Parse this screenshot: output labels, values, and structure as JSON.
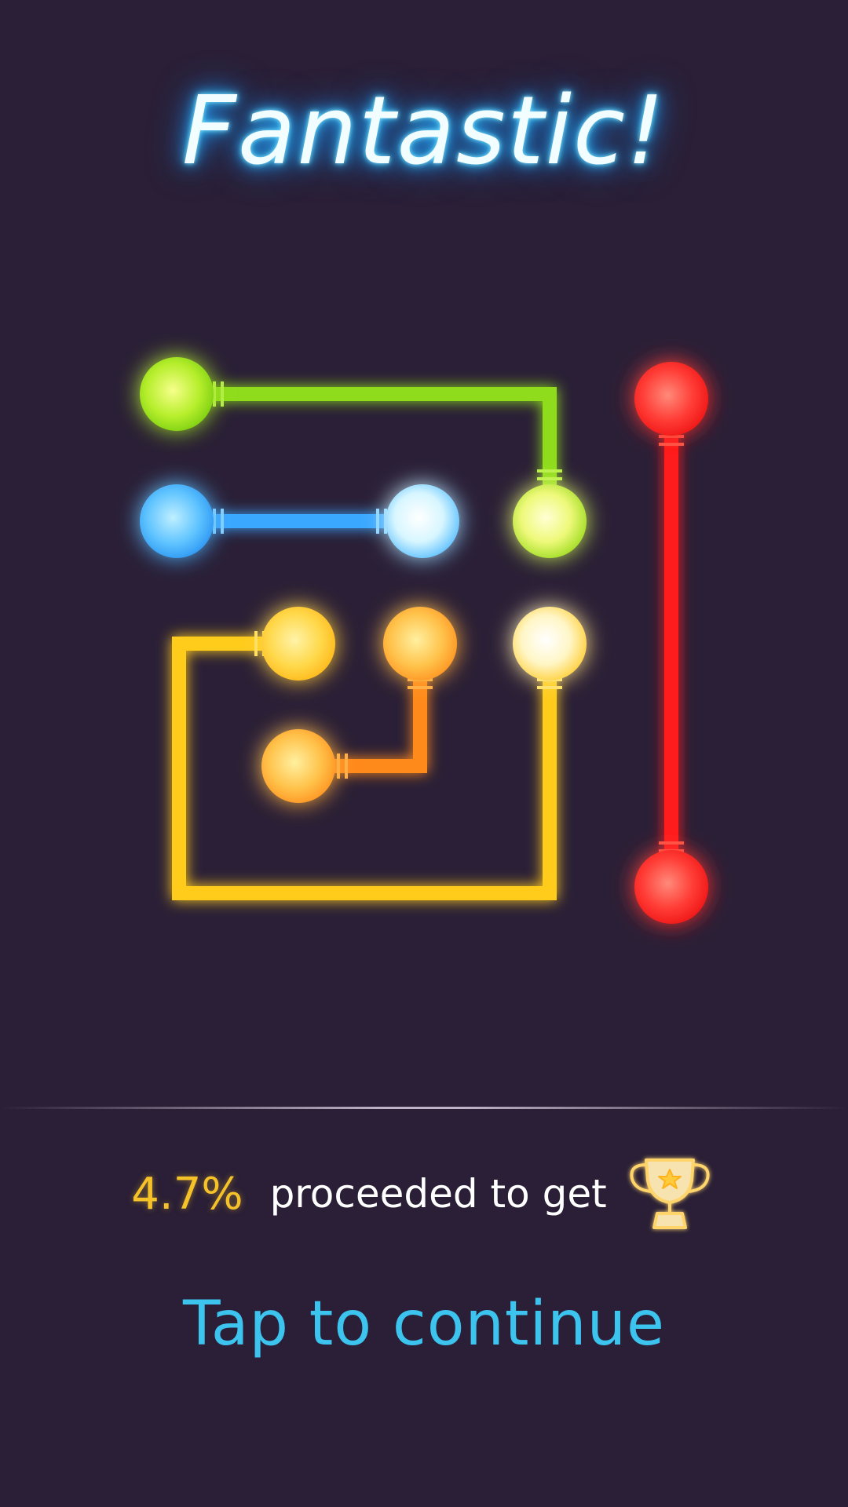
{
  "header": {
    "title": "Fantastic!"
  },
  "result": {
    "percent": "4.7%",
    "text": "proceeded to get",
    "trophy_icon": "trophy-icon"
  },
  "actions": {
    "continue_label": "Tap to continue"
  },
  "colors": {
    "background": "#2a1f36",
    "title_glow": "#35c4ff",
    "percent": "#f5c22a",
    "continue": "#3cc3ee",
    "green": "#8edc1e",
    "blue": "#3aa8ff",
    "yellow": "#ffcc1a",
    "orange": "#ff8a1e",
    "red": "#ff1f1f"
  },
  "puzzle": {
    "connections": [
      {
        "color": "green",
        "endpoints": [
          "green-light-start",
          "green-light-end"
        ]
      },
      {
        "color": "blue",
        "endpoints": [
          "blue-light-start",
          "blue-light-end"
        ]
      },
      {
        "color": "yellow",
        "endpoints": [
          "yellow-light-start",
          "yellow-light-end"
        ]
      },
      {
        "color": "orange",
        "endpoints": [
          "orange-light-start",
          "orange-light-end"
        ]
      },
      {
        "color": "red",
        "endpoints": [
          "red-light-start",
          "red-light-end"
        ]
      }
    ]
  }
}
